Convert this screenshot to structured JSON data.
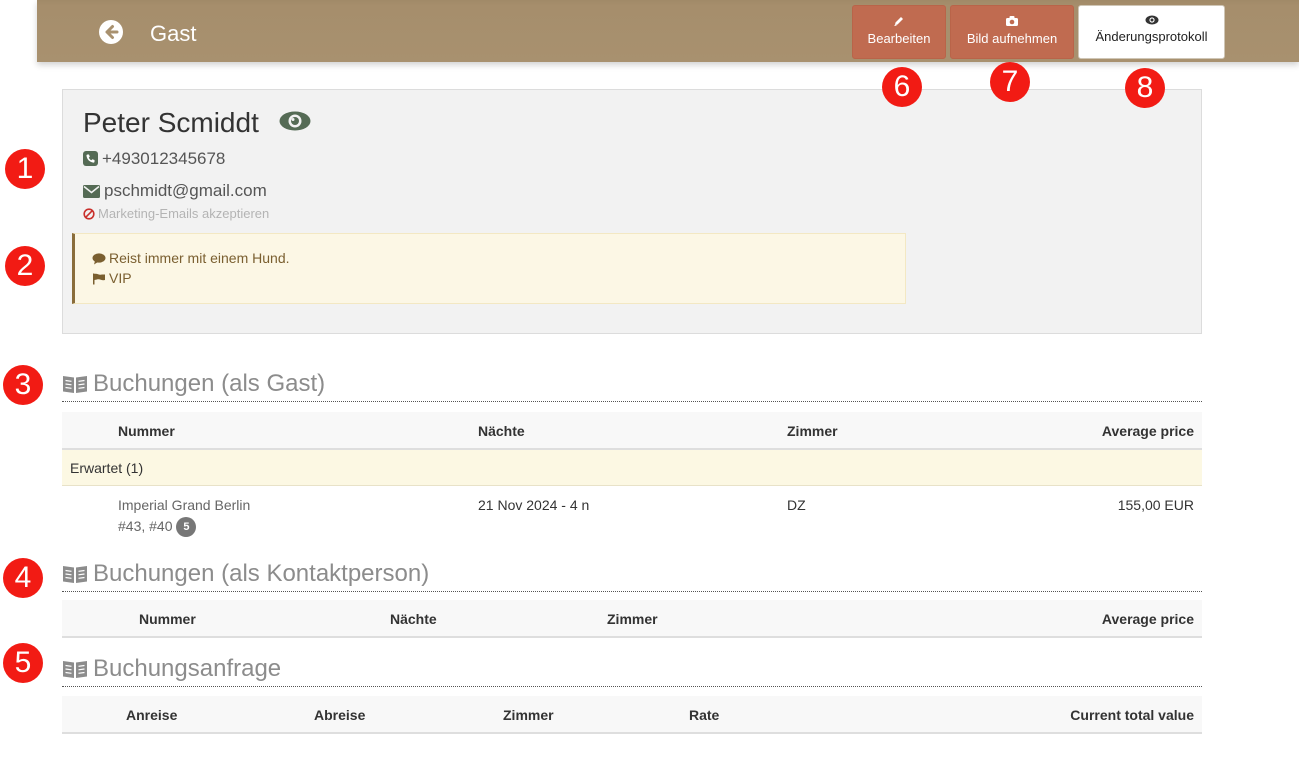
{
  "header": {
    "title": "Gast",
    "back_icon": "arrow-circle-left-icon",
    "buttons": [
      {
        "label": "Bearbeiten",
        "icon": "pencil-icon"
      },
      {
        "label": "Bild aufnehmen",
        "icon": "camera-icon"
      },
      {
        "label": "Änderungsprotokoll",
        "icon": "eye-icon"
      }
    ]
  },
  "guest": {
    "name": "Peter Scmiddt",
    "phone": "+493012345678",
    "email": "pschmidt@gmail.com",
    "marketing": "Marketing-Emails akzeptieren",
    "notes": [
      {
        "icon": "comment-icon",
        "text": "Reist immer mit einem Hund."
      },
      {
        "icon": "flag-icon",
        "text": "VIP"
      }
    ]
  },
  "sections": {
    "as_guest": {
      "title": "Buchungen (als Gast)",
      "columns": [
        "Nummer",
        "Nächte",
        "Zimmer",
        "Average price"
      ],
      "group_label": "Erwartet (1)",
      "rows": [
        {
          "hotel": "Imperial Grand Berlin",
          "numbers": "#43, #40",
          "badge": "5",
          "nights": "21 Nov 2024 - 4 n",
          "room": "DZ",
          "price": "155,00 EUR"
        }
      ]
    },
    "as_contact": {
      "title": "Buchungen (als Kontaktperson)",
      "columns": [
        "Nummer",
        "Nächte",
        "Zimmer",
        "Average price"
      ]
    },
    "requests": {
      "title": "Buchungsanfrage",
      "columns": [
        "Anreise",
        "Abreise",
        "Zimmer",
        "Rate",
        "Current total value"
      ]
    }
  },
  "markers": [
    "1",
    "2",
    "3",
    "4",
    "5",
    "6",
    "7",
    "8"
  ],
  "colors": {
    "header_bg": "#a8916f",
    "button_red": "#c06b50",
    "marker_red": "#f21b14",
    "notes_bg": "#fcf7e5",
    "notes_border": "#8a6d3b"
  }
}
